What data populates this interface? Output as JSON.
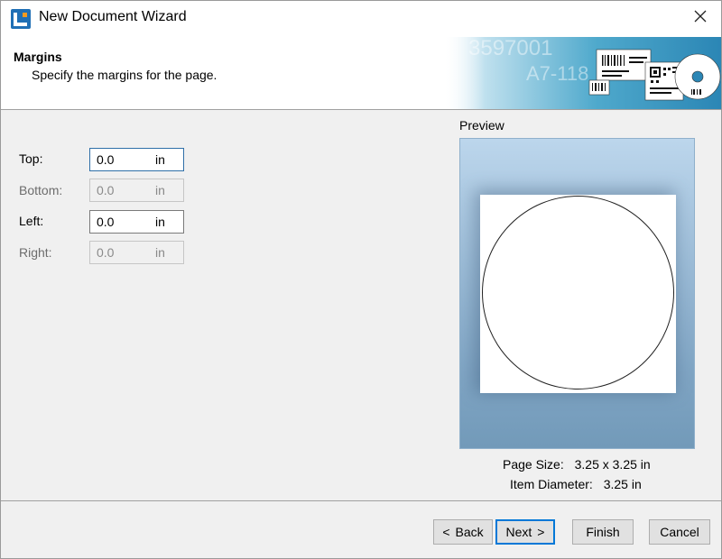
{
  "window": {
    "title": "New Document Wizard",
    "icon": "app-logo-icon",
    "close_icon": "close-icon",
    "accent_color": "#2f6fa8",
    "focus_color": "#0078d7"
  },
  "header": {
    "title": "Margins",
    "subtitle": "Specify the margins for the page.",
    "banner_texts": [
      "3597001",
      "A7-118"
    ]
  },
  "form": {
    "fields": [
      {
        "label": "Top:",
        "value": "0.0",
        "unit": "in",
        "enabled": true,
        "focused": true
      },
      {
        "label": "Bottom:",
        "value": "0.0",
        "unit": "in",
        "enabled": false,
        "focused": false
      },
      {
        "label": "Left:",
        "value": "0.0",
        "unit": "in",
        "enabled": true,
        "focused": false
      },
      {
        "label": "Right:",
        "value": "0.0",
        "unit": "in",
        "enabled": false,
        "focused": false
      }
    ]
  },
  "preview": {
    "label": "Preview",
    "page_size_label": "Page Size:",
    "page_size_value": "3.25 x 3.25 in",
    "item_diameter_label": "Item Diameter:",
    "item_diameter_value": "3.25 in"
  },
  "footer": {
    "back_label": "Back",
    "back_icon": "chevron-left",
    "next_label": "Next",
    "next_icon": "chevron-right",
    "finish_label": "Finish",
    "cancel_label": "Cancel"
  }
}
